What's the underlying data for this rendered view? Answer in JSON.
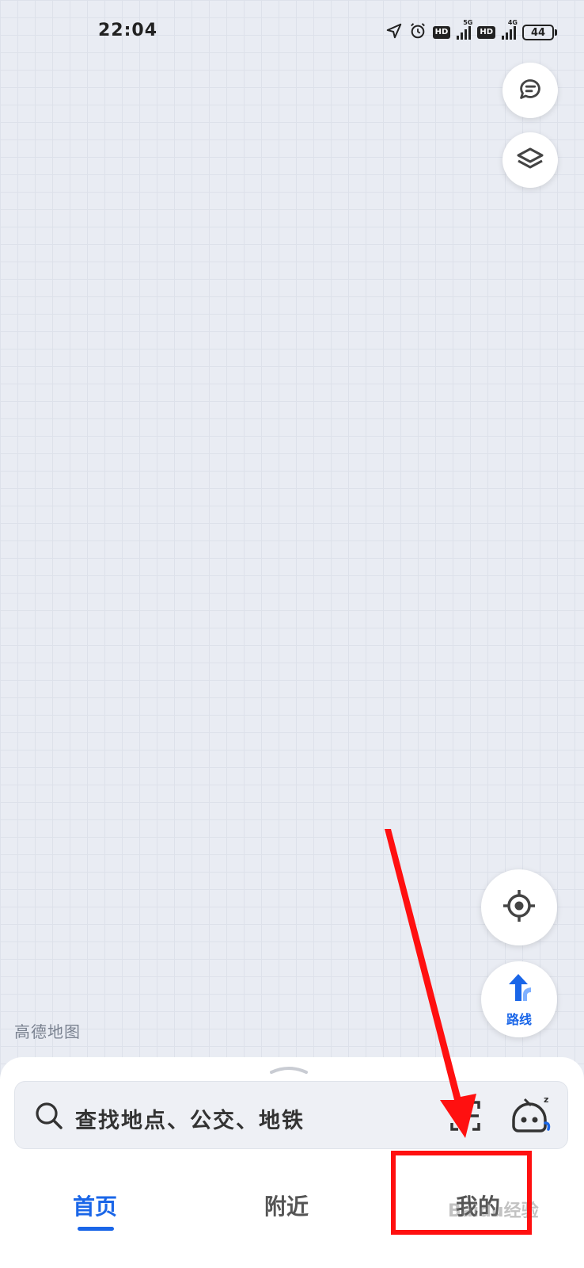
{
  "status_bar": {
    "time": "22:04",
    "hd_label": "HD",
    "network_1": "5G",
    "network_2": "4G",
    "battery": "44"
  },
  "map": {
    "logo_text": "高德地图"
  },
  "controls": {
    "route_label": "路线"
  },
  "search": {
    "placeholder": "查找地点、公交、地铁"
  },
  "tabs": [
    {
      "label": "首页",
      "active": true
    },
    {
      "label": "附近",
      "active": false
    },
    {
      "label": "我的",
      "active": false
    }
  ],
  "watermark": "Baidu经验",
  "colors": {
    "accent": "#1a66e8",
    "annotation": "#ff1010",
    "map_background": "#e9ecf3"
  }
}
